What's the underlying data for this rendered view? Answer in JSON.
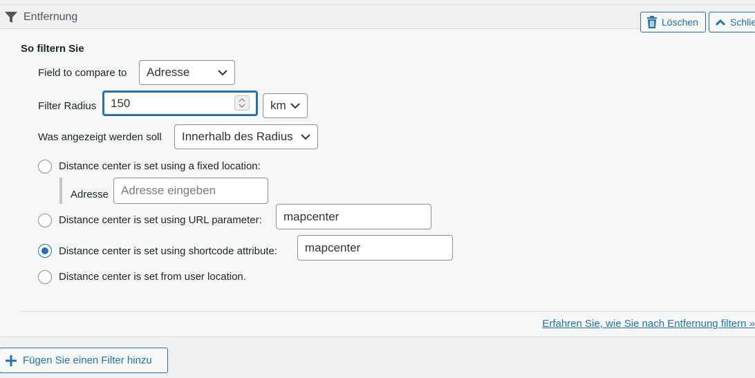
{
  "header": {
    "title": "Entfernung",
    "delete_label": "Löschen",
    "close_label": "Schlie"
  },
  "section": {
    "title": "So filtern Sie"
  },
  "fields": {
    "compare_label": "Field to compare to",
    "compare_value": "Adresse",
    "radius_label": "Filter Radius",
    "radius_value": "150",
    "unit_value": "km",
    "display_label": "Was angezeigt werden soll",
    "display_value": "Innerhalb des Radius"
  },
  "options": {
    "fixed_label": "Distance center is set using a fixed location:",
    "fixed_address_label": "Adresse",
    "fixed_address_placeholder": "Adresse eingeben",
    "url_label": "Distance center is set using URL parameter:",
    "url_value": "mapcenter",
    "shortcode_label": "Distance center is set using shortcode attribute:",
    "shortcode_value": "mapcenter",
    "user_label": "Distance center is set from user location.",
    "selected": "shortcode"
  },
  "footer": {
    "learn_link": "Erfahren Sie, wie Sie nach Entfernung filtern »",
    "add_filter": "Fügen Sie einen Filter hinzu"
  },
  "colors": {
    "accent": "#2271b1",
    "text": "#1d2327",
    "border": "#8c8f94"
  }
}
